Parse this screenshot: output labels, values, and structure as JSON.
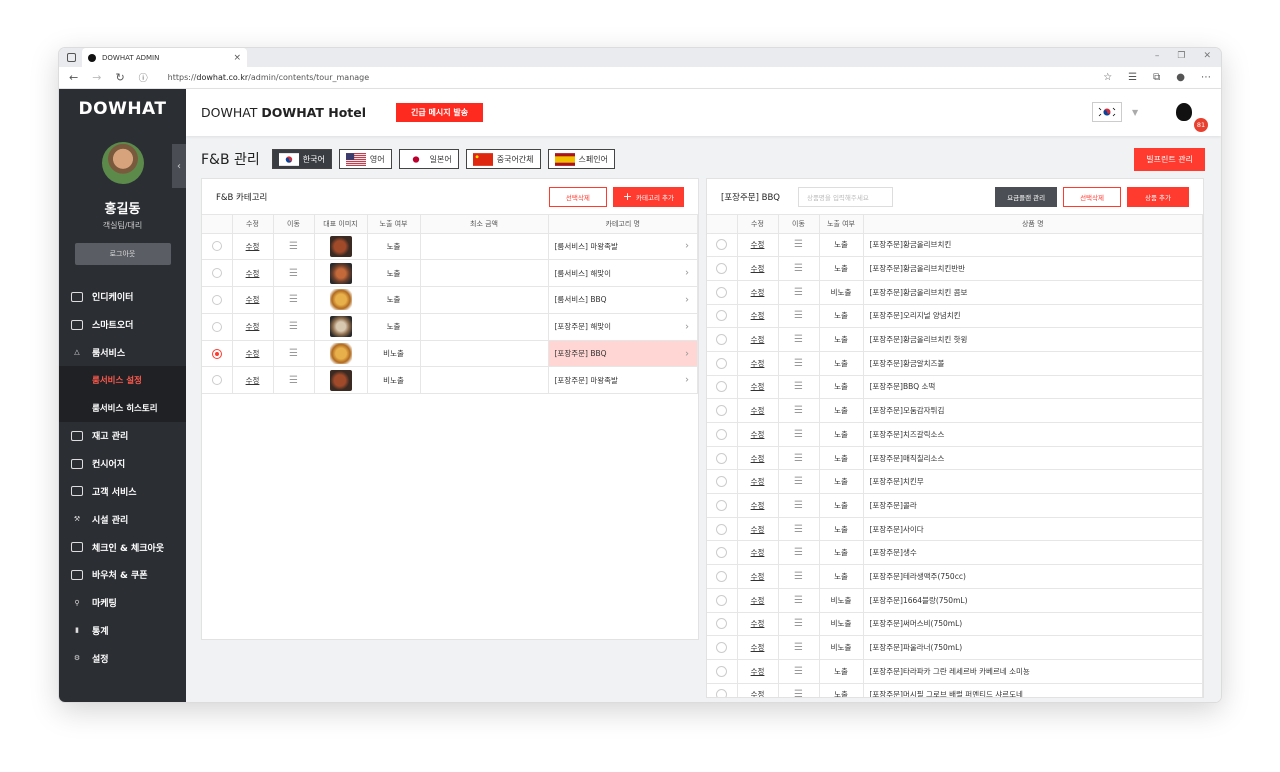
{
  "browser": {
    "tab_title": "DOWHAT ADMIN",
    "url_prefix": "https://",
    "url_domain": "dowhat.co.kr",
    "url_path": "/admin/contents/tour_manage"
  },
  "sidebar": {
    "logo": "DOWHAT",
    "user_name": "홍길동",
    "user_role": "객실팀/대리",
    "logout_label": "로그아웃",
    "items": [
      {
        "label": "인디케이터",
        "icon": "monitor-icon"
      },
      {
        "label": "스마트오더",
        "icon": "tablet-icon"
      },
      {
        "label": "룸서비스",
        "icon": "tray-icon"
      },
      {
        "label": "룸서비스 설정",
        "sub": true,
        "active": true
      },
      {
        "label": "룸서비스 히스토리",
        "sub": true
      },
      {
        "label": "재고 관리",
        "icon": "box-icon"
      },
      {
        "label": "컨시어지",
        "icon": "concierge-icon"
      },
      {
        "label": "고객 서비스",
        "icon": "chat-icon"
      },
      {
        "label": "시설 관리",
        "icon": "wrench-icon"
      },
      {
        "label": "체크인 & 체크아웃",
        "icon": "door-icon"
      },
      {
        "label": "바우처 & 쿠폰",
        "icon": "ticket-icon"
      },
      {
        "label": "마케팅",
        "icon": "pin-icon"
      },
      {
        "label": "통계",
        "icon": "bar-chart-icon"
      },
      {
        "label": "설정",
        "icon": "gear-icon"
      }
    ]
  },
  "header": {
    "hotel_prefix": "DOWHAT ",
    "hotel_name": "DOWHAT Hotel",
    "alert_button": "긴급 메시지 발송",
    "notification_count": "81"
  },
  "page": {
    "title": "F&B 관리",
    "languages": [
      {
        "label": "한국어",
        "active": true
      },
      {
        "label": "영어"
      },
      {
        "label": "일본어"
      },
      {
        "label": "중국어간체"
      },
      {
        "label": "스페인어"
      }
    ],
    "blueprint_button": "빌프린트 관리"
  },
  "left_panel": {
    "title": "F&B 카테고리",
    "delete_button": "선택삭제",
    "add_button": "카테고리 추가",
    "columns": [
      "",
      "수정",
      "이동",
      "대표 이미지",
      "노출 여부",
      "최소 금액",
      "카테고리 명"
    ],
    "rows": [
      {
        "edit": "수정",
        "visibility": "노출",
        "min_price": "",
        "name": "[룸서비스] 마왕족발",
        "selected": false
      },
      {
        "edit": "수정",
        "visibility": "노출",
        "min_price": "",
        "name": "[룸서비스] 해맞이",
        "selected": false
      },
      {
        "edit": "수정",
        "visibility": "노출",
        "min_price": "",
        "name": "[룸서비스] BBQ",
        "selected": false
      },
      {
        "edit": "수정",
        "visibility": "노출",
        "min_price": "",
        "name": "[포장주문] 해맞이",
        "selected": false
      },
      {
        "edit": "수정",
        "visibility": "비노출",
        "min_price": "",
        "name": "[포장주문] BBQ",
        "selected": true
      },
      {
        "edit": "수정",
        "visibility": "비노출",
        "min_price": "",
        "name": "[포장주문] 마왕족발",
        "selected": false
      }
    ]
  },
  "right_panel": {
    "title": "[포장주문] BBQ",
    "search_placeholder": "상품명을 입력해주세요",
    "plan_button": "요금플랜 관리",
    "delete_button": "선택삭제",
    "add_button": "상품 추가",
    "columns": [
      "",
      "수정",
      "이동",
      "노출 여부",
      "상품 명"
    ],
    "rows": [
      {
        "edit": "수정",
        "visibility": "노출",
        "name": "[포장주문]황금올리브치킨"
      },
      {
        "edit": "수정",
        "visibility": "노출",
        "name": "[포장주문]황금올리브치킨반반"
      },
      {
        "edit": "수정",
        "visibility": "비노출",
        "name": "[포장주문]황금올리브치킨 콤보"
      },
      {
        "edit": "수정",
        "visibility": "노출",
        "name": "[포장주문]오리지널 양념치킨"
      },
      {
        "edit": "수정",
        "visibility": "노출",
        "name": "[포장주문]황금올리브치킨 핫윙"
      },
      {
        "edit": "수정",
        "visibility": "노출",
        "name": "[포장주문]황금알치즈볼"
      },
      {
        "edit": "수정",
        "visibility": "노출",
        "name": "[포장주문]BBQ 소떡"
      },
      {
        "edit": "수정",
        "visibility": "노출",
        "name": "[포장주문]모둠감자튀김"
      },
      {
        "edit": "수정",
        "visibility": "노출",
        "name": "[포장주문]치즈갈릭소스"
      },
      {
        "edit": "수정",
        "visibility": "노출",
        "name": "[포장주문]매직칠리소스"
      },
      {
        "edit": "수정",
        "visibility": "노출",
        "name": "[포장주문]치킨무"
      },
      {
        "edit": "수정",
        "visibility": "노출",
        "name": "[포장주문]콜라"
      },
      {
        "edit": "수정",
        "visibility": "노출",
        "name": "[포장주문]사이다"
      },
      {
        "edit": "수정",
        "visibility": "노출",
        "name": "[포장주문]생수"
      },
      {
        "edit": "수정",
        "visibility": "노출",
        "name": "[포장주문]테라생맥주(750cc)"
      },
      {
        "edit": "수정",
        "visibility": "비노출",
        "name": "[포장주문]1664블랑(750mL)"
      },
      {
        "edit": "수정",
        "visibility": "비노출",
        "name": "[포장주문]써머스비(750mL)"
      },
      {
        "edit": "수정",
        "visibility": "비노출",
        "name": "[포장주문]파울라너(750mL)"
      },
      {
        "edit": "수정",
        "visibility": "노출",
        "name": "[포장주문]타라파카 그란 레세르바 카베르네 소미뇽"
      },
      {
        "edit": "수정",
        "visibility": "노출",
        "name": "[포장주문]머시필 그로브 배럴 퍼멘티드 샤르도네"
      }
    ]
  },
  "colors": {
    "accent": "#ff3b30",
    "sidebar": "#2b2e33"
  }
}
